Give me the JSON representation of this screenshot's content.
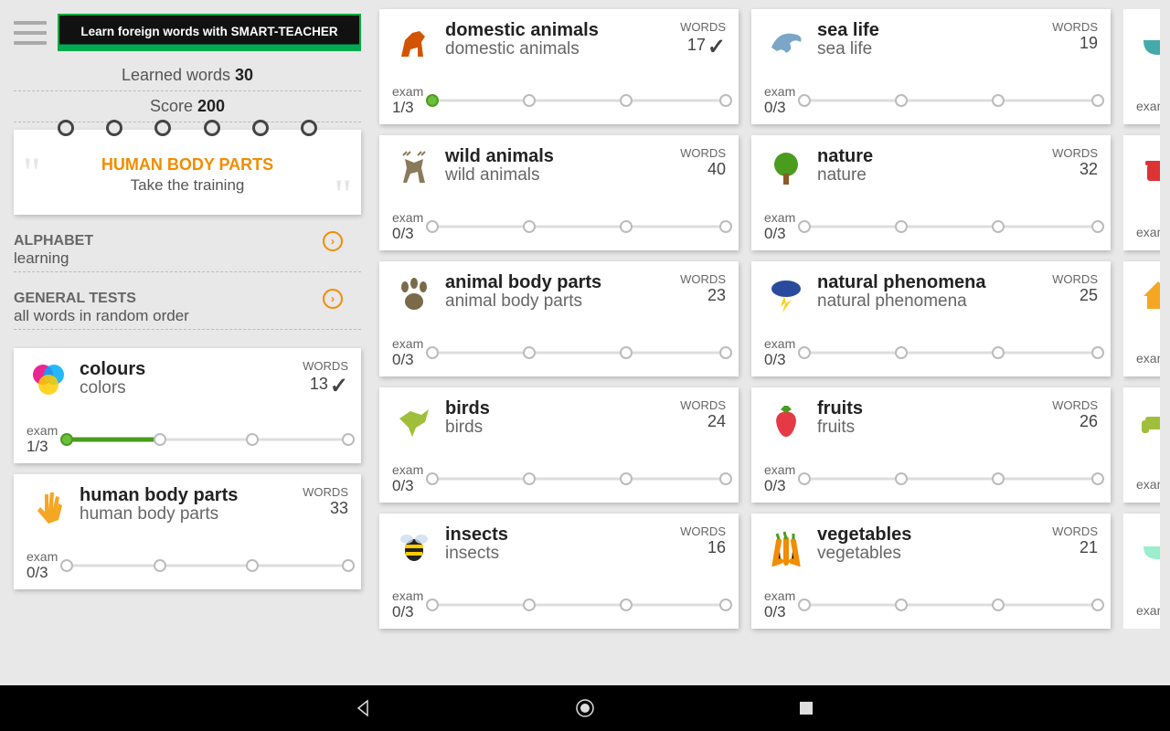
{
  "banner": "Learn foreign words with SMART-TEACHER",
  "learned_label": "Learned words",
  "learned_n": "30",
  "score_label": "Score",
  "score_n": "200",
  "training_title": "HUMAN BODY PARTS",
  "training_sub": "Take the training",
  "alpha_title": "ALPHABET",
  "alpha_sub": "learning",
  "tests_title": "GENERAL TESTS",
  "tests_sub": "all words in random order",
  "words_label": "WORDS",
  "exam_label": "exam",
  "sidebar_cards": [
    {
      "title": "colours",
      "sub": "colors",
      "words": "13",
      "exam": "1/3",
      "checked": true,
      "progress": 33,
      "icon": "colours"
    },
    {
      "title": "human body parts",
      "sub": "human body parts",
      "words": "33",
      "exam": "0/3",
      "checked": false,
      "progress": 0,
      "icon": "hand"
    }
  ],
  "col1": [
    {
      "title": "domestic animals",
      "sub": "domestic animals",
      "words": "17",
      "exam": "1/3",
      "checked": true,
      "progress": 1,
      "icon": "dog"
    },
    {
      "title": "wild animals",
      "sub": "wild animals",
      "words": "40",
      "exam": "0/3",
      "checked": false,
      "progress": 0,
      "icon": "deer"
    },
    {
      "title": "animal body parts",
      "sub": "animal body parts",
      "words": "23",
      "exam": "0/3",
      "checked": false,
      "progress": 0,
      "icon": "paw"
    },
    {
      "title": "birds",
      "sub": "birds",
      "words": "24",
      "exam": "0/3",
      "checked": false,
      "progress": 0,
      "icon": "bird"
    },
    {
      "title": "insects",
      "sub": "insects",
      "words": "16",
      "exam": "0/3",
      "checked": false,
      "progress": 0,
      "icon": "bee"
    }
  ],
  "col2": [
    {
      "title": "sea life",
      "sub": "sea life",
      "words": "19",
      "exam": "0/3",
      "checked": false,
      "progress": 0,
      "icon": "dolphin"
    },
    {
      "title": "nature",
      "sub": "nature",
      "words": "32",
      "exam": "0/3",
      "checked": false,
      "progress": 0,
      "icon": "tree"
    },
    {
      "title": "natural phenomena",
      "sub": "natural phenomena",
      "words": "25",
      "exam": "0/3",
      "checked": false,
      "progress": 0,
      "icon": "storm"
    },
    {
      "title": "fruits",
      "sub": "fruits",
      "words": "26",
      "exam": "0/3",
      "checked": false,
      "progress": 0,
      "icon": "strawberry"
    },
    {
      "title": "vegetables",
      "sub": "vegetables",
      "words": "21",
      "exam": "0/3",
      "checked": false,
      "progress": 0,
      "icon": "carrot"
    }
  ],
  "col3": [
    {
      "title": "",
      "sub": "",
      "words": "",
      "exam": "",
      "checked": false,
      "progress": 0,
      "icon": "bowl"
    },
    {
      "title": "",
      "sub": "",
      "words": "",
      "exam": "",
      "checked": false,
      "progress": 0,
      "icon": "pot"
    },
    {
      "title": "",
      "sub": "",
      "words": "",
      "exam": "",
      "checked": false,
      "progress": 0,
      "icon": "house"
    },
    {
      "title": "",
      "sub": "",
      "words": "",
      "exam": "",
      "checked": false,
      "progress": 0,
      "icon": "sofa"
    },
    {
      "title": "",
      "sub": "",
      "words": "",
      "exam": "",
      "checked": false,
      "progress": 0,
      "icon": "bath"
    }
  ],
  "icons": {
    "colours": "#e6007e",
    "hand": "#f5a623",
    "dog": "#d35400",
    "deer": "#8a7a5a",
    "paw": "#7a6a4a",
    "bird": "#9fbf3a",
    "bee": "#f5c518",
    "dolphin": "#7aa7c7",
    "tree": "#4a9c1e",
    "storm": "#2a4a9c",
    "strawberry": "#e63946",
    "carrot": "#f28c00",
    "bowl": "#4aa",
    "pot": "#d33",
    "house": "#f5a623",
    "sofa": "#9fbf3a",
    "bath": "#9ec"
  }
}
